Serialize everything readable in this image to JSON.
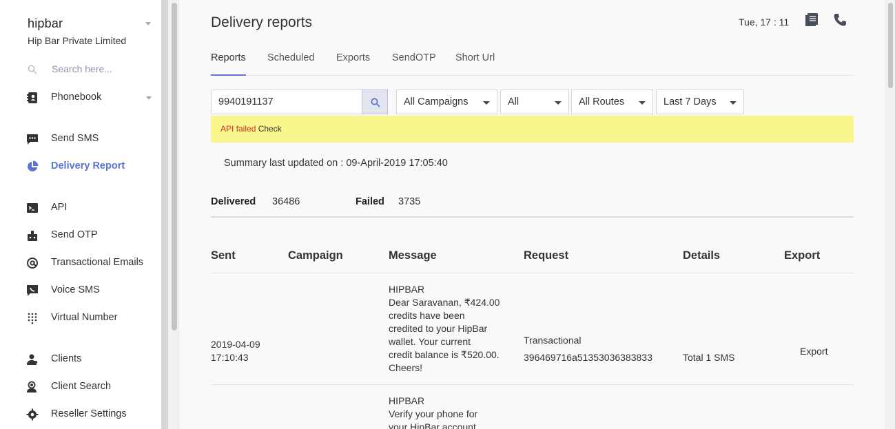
{
  "sidebar": {
    "brand": "hipbar",
    "company": "Hip Bar Private Limited",
    "search_placeholder": "Search here...",
    "items": [
      {
        "label": "Phonebook",
        "icon": "phonebook-icon"
      },
      {
        "label": "Send SMS",
        "icon": "sms-icon"
      },
      {
        "label": "Delivery Report",
        "icon": "pie-chart-icon",
        "active": true
      },
      {
        "label": "API",
        "icon": "terminal-icon"
      },
      {
        "label": "Send OTP",
        "icon": "otp-icon"
      },
      {
        "label": "Transactional Emails",
        "icon": "at-icon"
      },
      {
        "label": "Voice SMS",
        "icon": "voice-icon"
      },
      {
        "label": "Virtual Number",
        "icon": "dialpad-icon"
      },
      {
        "label": "Clients",
        "icon": "clients-icon"
      },
      {
        "label": "Client Search",
        "icon": "client-search-icon"
      },
      {
        "label": "Reseller Settings",
        "icon": "gear-icon"
      }
    ]
  },
  "header": {
    "title": "Delivery reports",
    "datetime": "Tue, 17 : 11"
  },
  "tabs": [
    "Reports",
    "Scheduled",
    "Exports",
    "SendOTP",
    "Short Url"
  ],
  "filters": {
    "phone_value": "9940191137",
    "campaign": "All Campaigns",
    "status": "All",
    "route": "All Routes",
    "period": "Last 7 Days"
  },
  "alert": {
    "error": "API failed",
    "action": "Check"
  },
  "summary": {
    "text": "Summary last updated on : 09-April-2019 17:05:40",
    "delivered_label": "Delivered",
    "delivered_value": "36486",
    "failed_label": "Failed",
    "failed_value": "3735"
  },
  "table": {
    "headers": [
      "Sent",
      "Campaign",
      "Message",
      "Request",
      "Details",
      "Export"
    ],
    "rows": [
      {
        "sent_date": "2019-04-09",
        "sent_time": "17:10:43",
        "campaign": "",
        "message_lines": [
          "HIPBAR",
          "Dear Saravanan, ₹424.00",
          "credits have been",
          "credited to your HipBar",
          "wallet. Your current",
          "credit balance is ₹520.00.",
          "Cheers!"
        ],
        "request_type": "Transactional",
        "request_id": "396469716a51353036383833",
        "details": "Total 1 SMS",
        "export": "Export"
      },
      {
        "message_lines": [
          "HIPBAR",
          "Verify your phone for",
          "your HipBar account"
        ]
      }
    ]
  },
  "colors": {
    "accent": "#5b74d6",
    "alert_bg": "#f8f68c",
    "alert_error": "#d62b2b"
  }
}
